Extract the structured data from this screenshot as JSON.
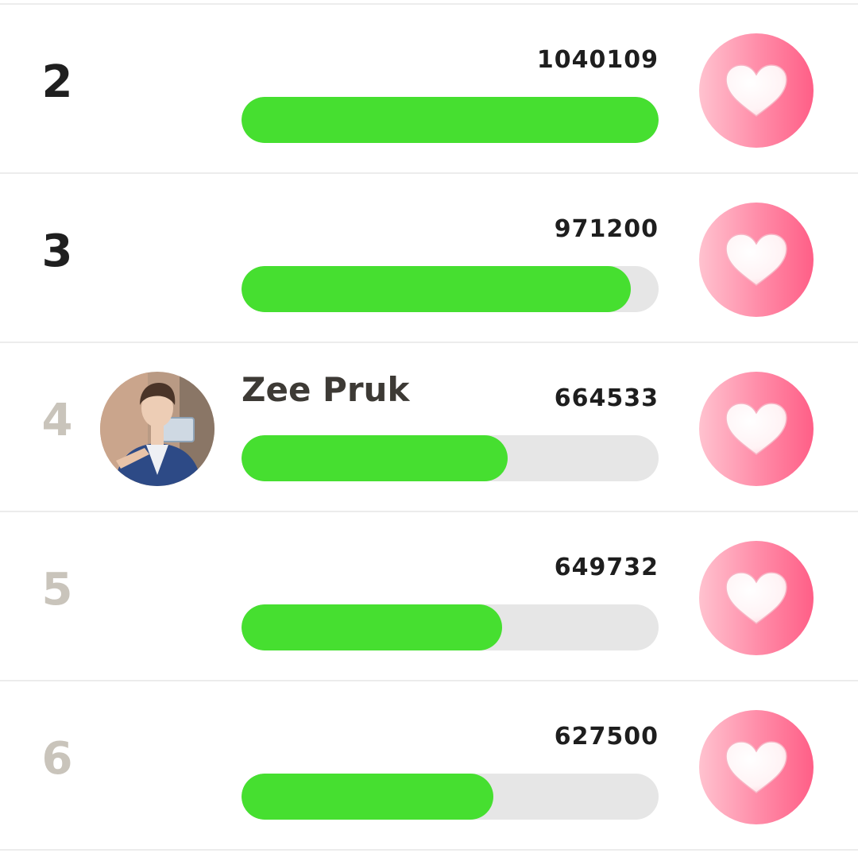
{
  "leaderboard": {
    "rows": [
      {
        "rank": "2",
        "name": "",
        "votes": "1040109",
        "progress": 1.0
      },
      {
        "rank": "3",
        "name": "",
        "votes": "971200",
        "progress": 0.934
      },
      {
        "rank": "4",
        "name": "Zee Pruk",
        "votes": "664533",
        "progress": 0.639
      },
      {
        "rank": "5",
        "name": "",
        "votes": "649732",
        "progress": 0.625
      },
      {
        "rank": "6",
        "name": "",
        "votes": "627500",
        "progress": 0.603
      }
    ]
  },
  "icons": {
    "vote": "heart-icon",
    "avatar": "avatar-photo"
  },
  "colors": {
    "progress_fill": "#46df30",
    "progress_track": "#e6e6e6",
    "rank_top": "#1f1f1f",
    "rank_low": "#c9c4bb",
    "vote_button": "#ff7b9c"
  }
}
